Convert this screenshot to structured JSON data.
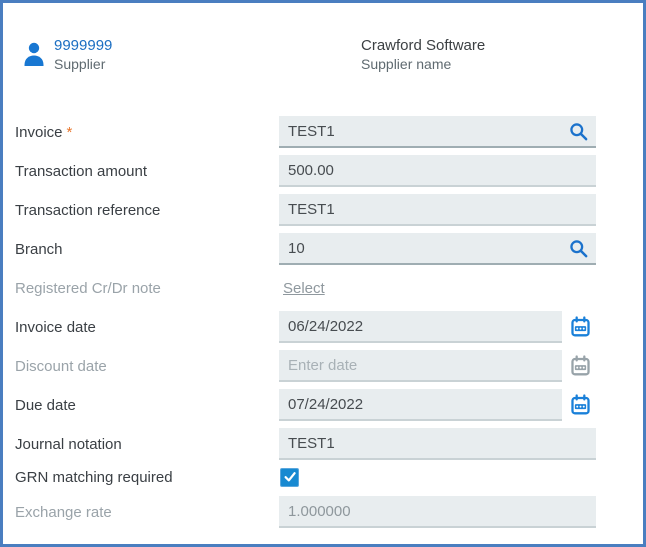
{
  "colors": {
    "frame_border": "#4a7ec0",
    "field_background": "#e8edef",
    "accent_blue": "#1b72cc",
    "required_orange": "#e8762c",
    "link_blue": "#1b6ec2",
    "checkbox_blue": "#1789d1",
    "disabled_gray": "#9aa3a9"
  },
  "header": {
    "supplier_code": "9999999",
    "supplier_code_caption": "Supplier",
    "supplier_name": "Crawford Software",
    "supplier_name_caption": "Supplier name",
    "person_icon": "person-icon"
  },
  "form": {
    "rows": [
      {
        "label": "Invoice",
        "required_mark": "*",
        "type": "search",
        "value": "TEST1",
        "icon": "search-icon"
      },
      {
        "label": "Transaction amount",
        "type": "text",
        "value": "500.00"
      },
      {
        "label": "Transaction reference",
        "type": "text",
        "value": "TEST1"
      },
      {
        "label": "Branch",
        "type": "search",
        "value": "10",
        "icon": "search-icon"
      },
      {
        "label": "Registered Cr/Dr note",
        "type": "link",
        "value": "Select",
        "disabled": true
      },
      {
        "label": "Invoice date",
        "type": "date",
        "value": "06/24/2022",
        "icon": "calendar-icon"
      },
      {
        "label": "Discount date",
        "type": "date",
        "value": "",
        "placeholder": "Enter date",
        "disabled": true,
        "icon": "calendar-icon"
      },
      {
        "label": "Due date",
        "type": "date",
        "value": "07/24/2022",
        "icon": "calendar-icon"
      },
      {
        "label": "Journal notation",
        "type": "text",
        "value": "TEST1"
      },
      {
        "label": "GRN matching required",
        "type": "checkbox",
        "checked": true
      },
      {
        "label": "Exchange rate",
        "type": "text",
        "value": "1.000000",
        "disabled": true
      }
    ]
  }
}
